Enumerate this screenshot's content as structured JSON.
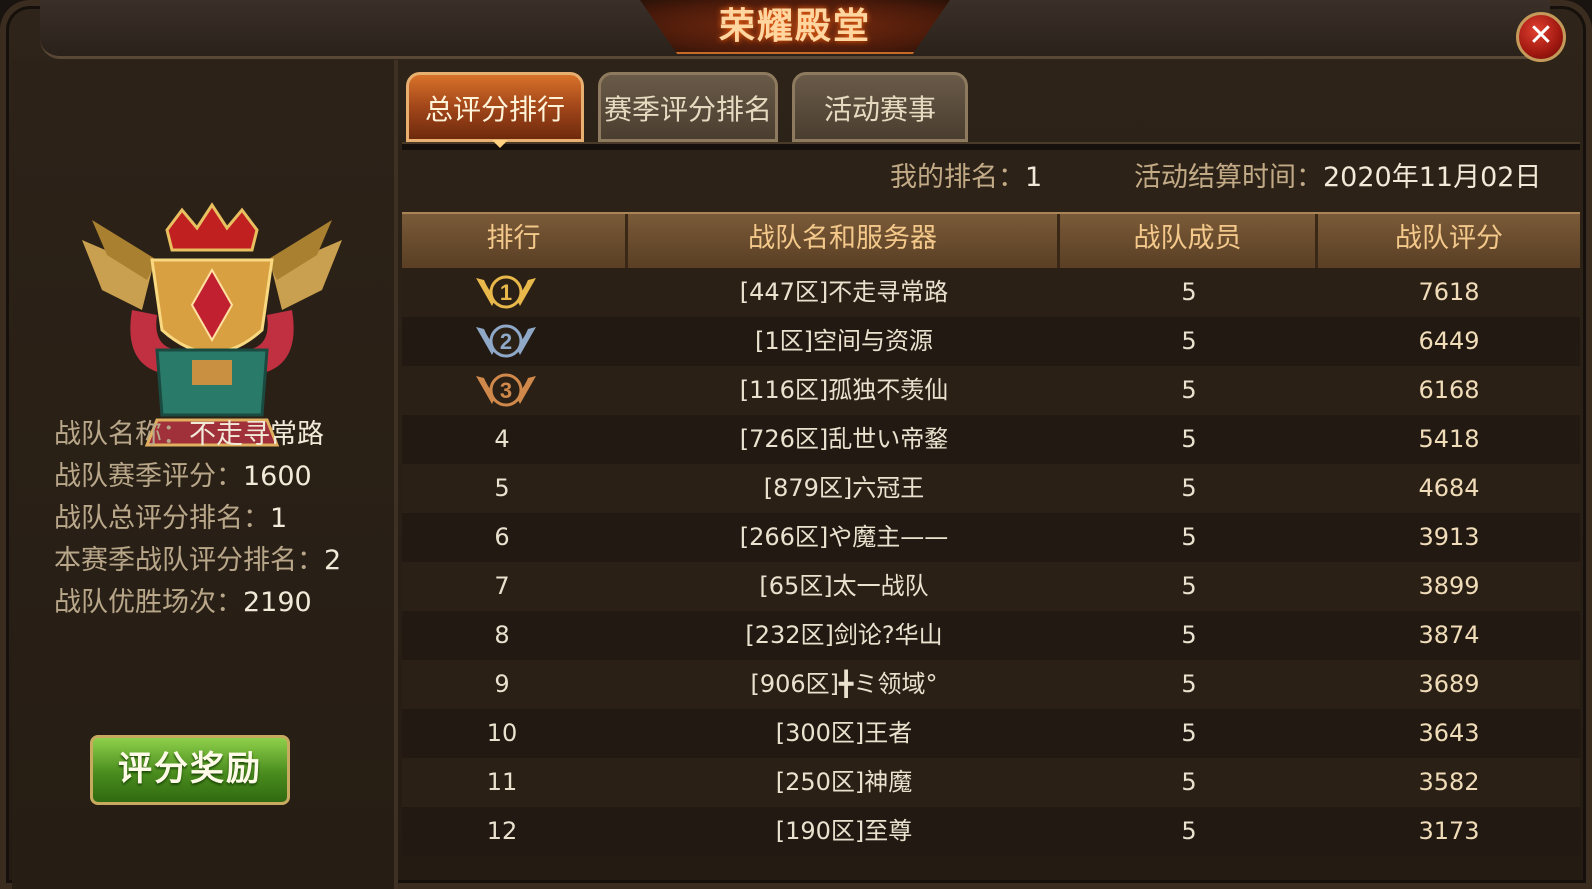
{
  "window": {
    "title": "荣耀殿堂"
  },
  "tabs": [
    {
      "label": "总评分排行",
      "active": true
    },
    {
      "label": "赛季评分排名",
      "active": false
    },
    {
      "label": "活动赛事",
      "active": false
    }
  ],
  "summary": {
    "my_rank_label": "我的排名：",
    "my_rank_value": "1",
    "settle_label": "活动结算时间：",
    "settle_value": "2020年11月02日"
  },
  "team_info": {
    "name_label": "战队名称：",
    "name_value": "不走寻常路",
    "season_score_label": "战队赛季评分：",
    "season_score_value": "1600",
    "total_rank_label": "战队总评分排名：",
    "total_rank_value": "1",
    "season_rank_label": "本赛季战队评分排名：",
    "season_rank_value": "2",
    "wins_label": "战队优胜场次：",
    "wins_value": "2190"
  },
  "reward_button": {
    "label": "评分奖励"
  },
  "table": {
    "headers": [
      "排行",
      "战队名和服务器",
      "战队成员",
      "战队评分"
    ],
    "rows": [
      {
        "rank": "1",
        "team": "[447区]不走寻常路",
        "members": "5",
        "score": "7618",
        "medal": "gold"
      },
      {
        "rank": "2",
        "team": "[1区]空间与资源",
        "members": "5",
        "score": "6449",
        "medal": "silver"
      },
      {
        "rank": "3",
        "team": "[116区]孤独不羡仙",
        "members": "5",
        "score": "6168",
        "medal": "bronze"
      },
      {
        "rank": "4",
        "team": "[726区]乱世い帝鍪",
        "members": "5",
        "score": "5418"
      },
      {
        "rank": "5",
        "team": "[879区]六冠王",
        "members": "5",
        "score": "4684"
      },
      {
        "rank": "6",
        "team": "[266区]や魔主——",
        "members": "5",
        "score": "3913"
      },
      {
        "rank": "7",
        "team": "[65区]太一战队",
        "members": "5",
        "score": "3899"
      },
      {
        "rank": "8",
        "team": "[232区]剑论?华山",
        "members": "5",
        "score": "3874"
      },
      {
        "rank": "9",
        "team": "[906区]╋ミ领域°",
        "members": "5",
        "score": "3689"
      },
      {
        "rank": "10",
        "team": "[300区]王者",
        "members": "5",
        "score": "3643"
      },
      {
        "rank": "11",
        "team": "[250区]神魔",
        "members": "5",
        "score": "3582"
      },
      {
        "rank": "12",
        "team": "[190区]至尊",
        "members": "5",
        "score": "3173"
      }
    ]
  },
  "colors": {
    "gold_medal": "#e8b84a",
    "silver_medal": "#8fa8c8",
    "bronze_medal": "#d0894a",
    "reward_button": "#5aa02a",
    "close_button": "#c02a1a"
  }
}
